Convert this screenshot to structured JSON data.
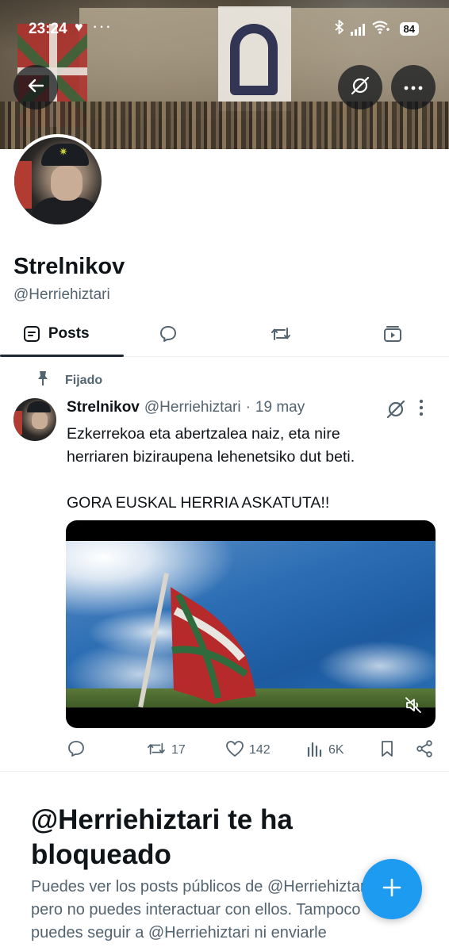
{
  "status_bar": {
    "time": "23:24",
    "battery": "84",
    "left_icons": [
      "heart-icon",
      "more-dots-icon"
    ],
    "right_icons": [
      "bluetooth-icon",
      "signal-icon",
      "wifi-icon",
      "battery-icon"
    ]
  },
  "header": {
    "back_icon": "arrow-left-icon",
    "grok_icon": "grok-icon",
    "more_icon": "more-horizontal-icon"
  },
  "profile": {
    "name": "Strelnikov",
    "handle": "@Herriehiztari"
  },
  "tabs": [
    {
      "label": "Posts",
      "icon": "posts-icon",
      "active": true
    },
    {
      "label": "",
      "icon": "reply-icon",
      "active": false
    },
    {
      "label": "",
      "icon": "repost-icon",
      "active": false
    },
    {
      "label": "",
      "icon": "media-icon",
      "active": false
    }
  ],
  "pinned_tweet": {
    "pinned_label": "Fijado",
    "author": "Strelnikov",
    "handle": "@Herriehiztari",
    "separator": "·",
    "date": "19 may",
    "text_line_1": "Ezkerrekoa eta abertzalea naiz, eta nire",
    "text_line_2": "herriaren biziraupena lehenetsiko dut beti.",
    "text_line_3": "GORA EUSKAL HERRIA ASKATUTA!!",
    "stats": {
      "reposts": "17",
      "likes": "142",
      "views": "6K"
    }
  },
  "blocked_notice": {
    "title": "@Herriehiztari te ha bloqueado",
    "body": "Puedes ver los posts públicos de @Herriehiztari, pero no puedes interactuar con ellos. Tampoco puedes seguir a @Herriehiztari ni enviarle"
  },
  "colors": {
    "accent": "#1d9bf0",
    "text_primary": "#0f1419",
    "text_secondary": "#536471"
  }
}
